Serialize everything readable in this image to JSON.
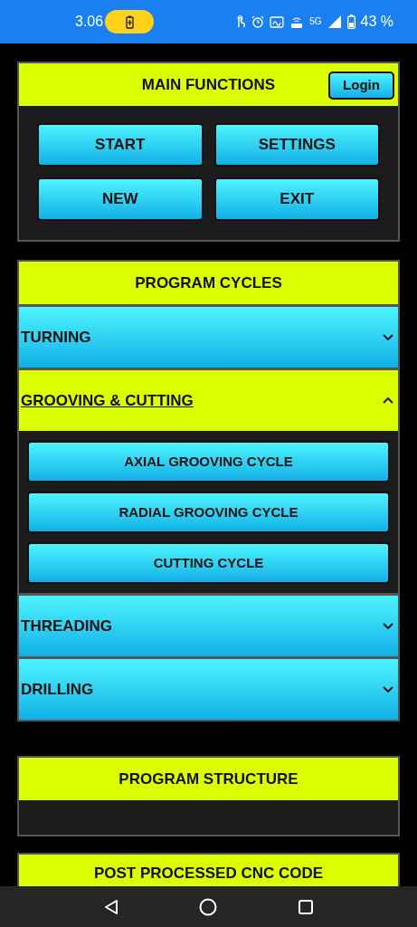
{
  "status_bar": {
    "time": "3.06",
    "network": "5G",
    "battery": "43 %"
  },
  "main_functions": {
    "title": "MAIN FUNCTIONS",
    "login": "Login",
    "buttons": [
      "START",
      "SETTINGS",
      "NEW",
      "EXIT"
    ]
  },
  "program_cycles": {
    "title": "PROGRAM CYCLES",
    "sections": [
      {
        "title": "TURNING",
        "expanded": false
      },
      {
        "title": "GROOVING & CUTTING",
        "expanded": true,
        "items": [
          "AXIAL GROOVING CYCLE",
          "RADIAL GROOVING CYCLE",
          "CUTTING CYCLE"
        ]
      },
      {
        "title": "THREADING",
        "expanded": false
      },
      {
        "title": "DRILLING",
        "expanded": false
      }
    ]
  },
  "program_structure": {
    "title": "PROGRAM STRUCTURE"
  },
  "post_processed": {
    "title": "POST PROCESSED CNC CODE"
  }
}
